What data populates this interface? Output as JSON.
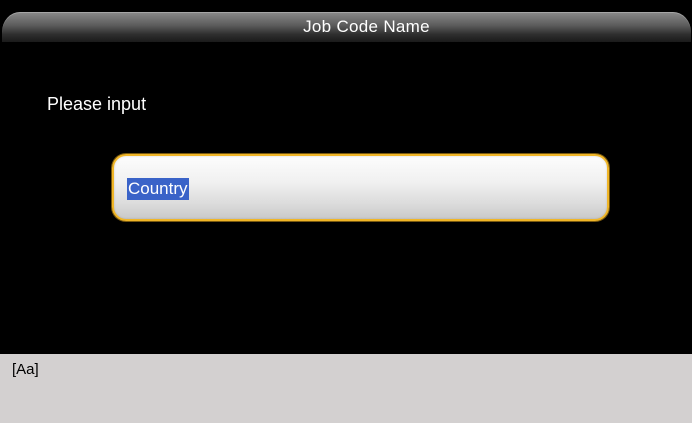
{
  "header": {
    "title": "Job Code Name"
  },
  "main": {
    "prompt": "Please input",
    "input": {
      "value": "Country",
      "selected": true
    }
  },
  "status_bar": {
    "input_mode": "[Aa]"
  },
  "colors": {
    "background": "#000000",
    "input_border": "#f0b628",
    "selection": "#3a63c8",
    "status_bar": "#d3d0d0"
  }
}
